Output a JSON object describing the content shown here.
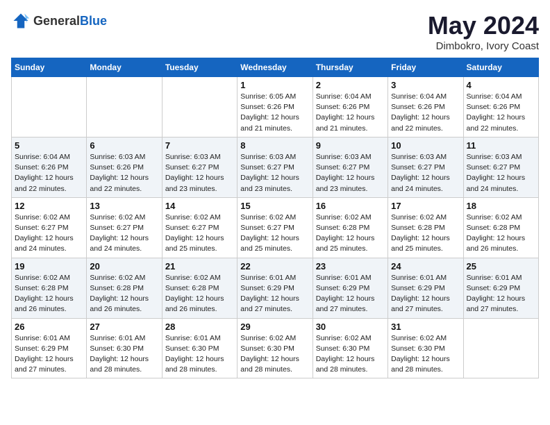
{
  "logo": {
    "text_general": "General",
    "text_blue": "Blue"
  },
  "title": {
    "month_year": "May 2024",
    "location": "Dimbokro, Ivory Coast"
  },
  "weekdays": [
    "Sunday",
    "Monday",
    "Tuesday",
    "Wednesday",
    "Thursday",
    "Friday",
    "Saturday"
  ],
  "weeks": [
    [
      {
        "day": "",
        "info": ""
      },
      {
        "day": "",
        "info": ""
      },
      {
        "day": "",
        "info": ""
      },
      {
        "day": "1",
        "info": "Sunrise: 6:05 AM\nSunset: 6:26 PM\nDaylight: 12 hours\nand 21 minutes."
      },
      {
        "day": "2",
        "info": "Sunrise: 6:04 AM\nSunset: 6:26 PM\nDaylight: 12 hours\nand 21 minutes."
      },
      {
        "day": "3",
        "info": "Sunrise: 6:04 AM\nSunset: 6:26 PM\nDaylight: 12 hours\nand 22 minutes."
      },
      {
        "day": "4",
        "info": "Sunrise: 6:04 AM\nSunset: 6:26 PM\nDaylight: 12 hours\nand 22 minutes."
      }
    ],
    [
      {
        "day": "5",
        "info": "Sunrise: 6:04 AM\nSunset: 6:26 PM\nDaylight: 12 hours\nand 22 minutes."
      },
      {
        "day": "6",
        "info": "Sunrise: 6:03 AM\nSunset: 6:26 PM\nDaylight: 12 hours\nand 22 minutes."
      },
      {
        "day": "7",
        "info": "Sunrise: 6:03 AM\nSunset: 6:27 PM\nDaylight: 12 hours\nand 23 minutes."
      },
      {
        "day": "8",
        "info": "Sunrise: 6:03 AM\nSunset: 6:27 PM\nDaylight: 12 hours\nand 23 minutes."
      },
      {
        "day": "9",
        "info": "Sunrise: 6:03 AM\nSunset: 6:27 PM\nDaylight: 12 hours\nand 23 minutes."
      },
      {
        "day": "10",
        "info": "Sunrise: 6:03 AM\nSunset: 6:27 PM\nDaylight: 12 hours\nand 24 minutes."
      },
      {
        "day": "11",
        "info": "Sunrise: 6:03 AM\nSunset: 6:27 PM\nDaylight: 12 hours\nand 24 minutes."
      }
    ],
    [
      {
        "day": "12",
        "info": "Sunrise: 6:02 AM\nSunset: 6:27 PM\nDaylight: 12 hours\nand 24 minutes."
      },
      {
        "day": "13",
        "info": "Sunrise: 6:02 AM\nSunset: 6:27 PM\nDaylight: 12 hours\nand 24 minutes."
      },
      {
        "day": "14",
        "info": "Sunrise: 6:02 AM\nSunset: 6:27 PM\nDaylight: 12 hours\nand 25 minutes."
      },
      {
        "day": "15",
        "info": "Sunrise: 6:02 AM\nSunset: 6:27 PM\nDaylight: 12 hours\nand 25 minutes."
      },
      {
        "day": "16",
        "info": "Sunrise: 6:02 AM\nSunset: 6:28 PM\nDaylight: 12 hours\nand 25 minutes."
      },
      {
        "day": "17",
        "info": "Sunrise: 6:02 AM\nSunset: 6:28 PM\nDaylight: 12 hours\nand 25 minutes."
      },
      {
        "day": "18",
        "info": "Sunrise: 6:02 AM\nSunset: 6:28 PM\nDaylight: 12 hours\nand 26 minutes."
      }
    ],
    [
      {
        "day": "19",
        "info": "Sunrise: 6:02 AM\nSunset: 6:28 PM\nDaylight: 12 hours\nand 26 minutes."
      },
      {
        "day": "20",
        "info": "Sunrise: 6:02 AM\nSunset: 6:28 PM\nDaylight: 12 hours\nand 26 minutes."
      },
      {
        "day": "21",
        "info": "Sunrise: 6:02 AM\nSunset: 6:28 PM\nDaylight: 12 hours\nand 26 minutes."
      },
      {
        "day": "22",
        "info": "Sunrise: 6:01 AM\nSunset: 6:29 PM\nDaylight: 12 hours\nand 27 minutes."
      },
      {
        "day": "23",
        "info": "Sunrise: 6:01 AM\nSunset: 6:29 PM\nDaylight: 12 hours\nand 27 minutes."
      },
      {
        "day": "24",
        "info": "Sunrise: 6:01 AM\nSunset: 6:29 PM\nDaylight: 12 hours\nand 27 minutes."
      },
      {
        "day": "25",
        "info": "Sunrise: 6:01 AM\nSunset: 6:29 PM\nDaylight: 12 hours\nand 27 minutes."
      }
    ],
    [
      {
        "day": "26",
        "info": "Sunrise: 6:01 AM\nSunset: 6:29 PM\nDaylight: 12 hours\nand 27 minutes."
      },
      {
        "day": "27",
        "info": "Sunrise: 6:01 AM\nSunset: 6:30 PM\nDaylight: 12 hours\nand 28 minutes."
      },
      {
        "day": "28",
        "info": "Sunrise: 6:01 AM\nSunset: 6:30 PM\nDaylight: 12 hours\nand 28 minutes."
      },
      {
        "day": "29",
        "info": "Sunrise: 6:02 AM\nSunset: 6:30 PM\nDaylight: 12 hours\nand 28 minutes."
      },
      {
        "day": "30",
        "info": "Sunrise: 6:02 AM\nSunset: 6:30 PM\nDaylight: 12 hours\nand 28 minutes."
      },
      {
        "day": "31",
        "info": "Sunrise: 6:02 AM\nSunset: 6:30 PM\nDaylight: 12 hours\nand 28 minutes."
      },
      {
        "day": "",
        "info": ""
      }
    ]
  ]
}
